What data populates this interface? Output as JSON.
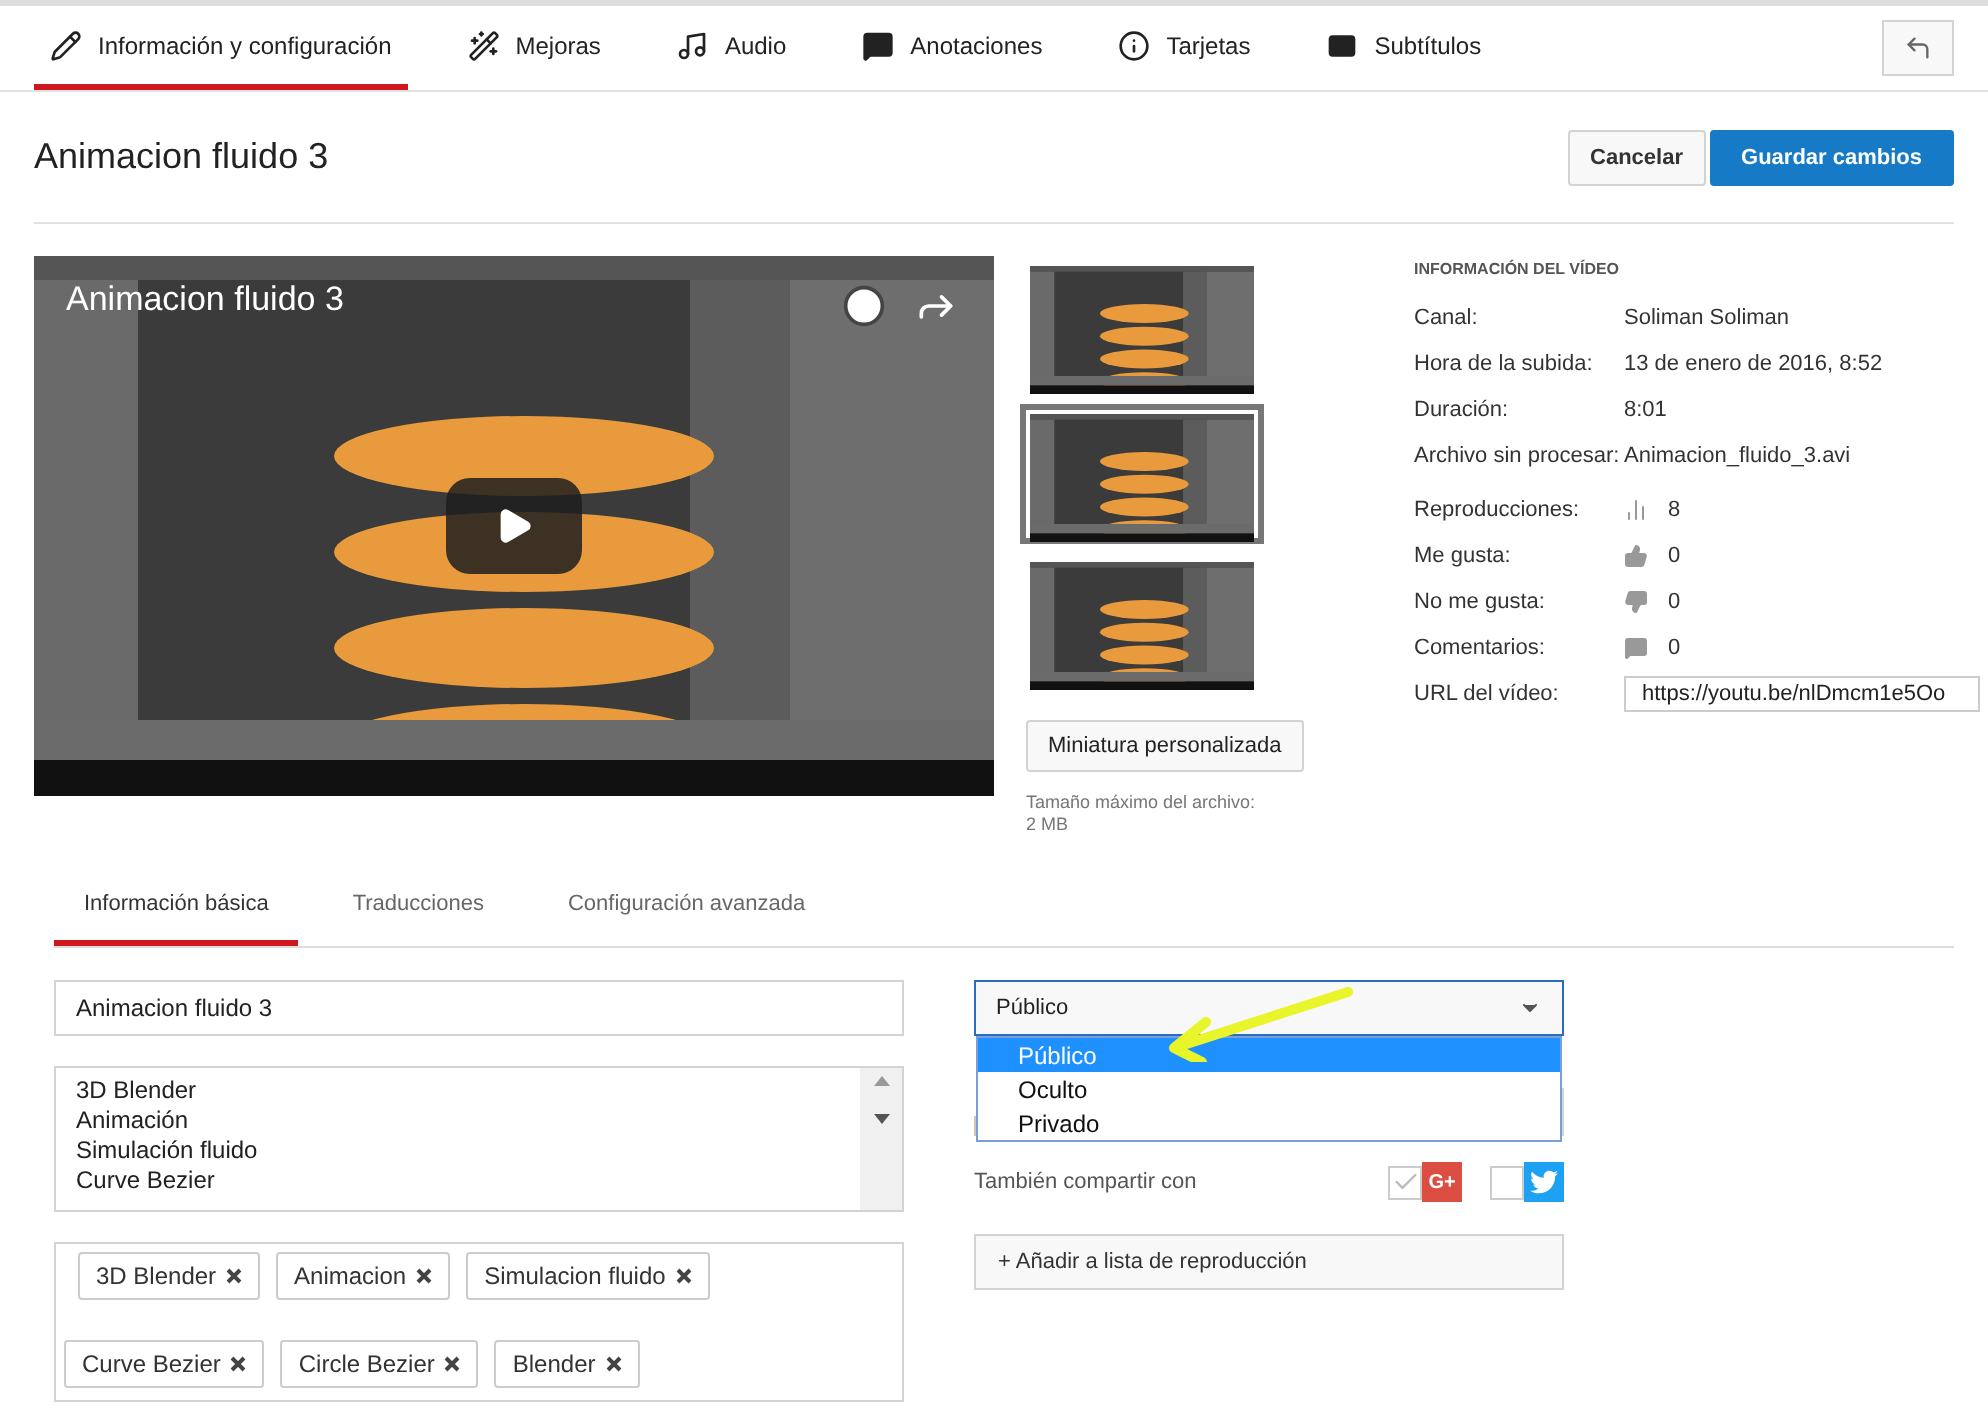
{
  "top_tabs": [
    {
      "label": "Información y configuración",
      "selected": true
    },
    {
      "label": "Mejoras",
      "selected": false
    },
    {
      "label": "Audio",
      "selected": false
    },
    {
      "label": "Anotaciones",
      "selected": false
    },
    {
      "label": "Tarjetas",
      "selected": false
    },
    {
      "label": "Subtítulos",
      "selected": false
    }
  ],
  "title": "Animacion fluido 3",
  "actions": {
    "cancel": "Cancelar",
    "save": "Guardar cambios"
  },
  "player": {
    "title": "Animacion fluido 3"
  },
  "thumbnails": [
    {
      "selected": false
    },
    {
      "selected": true
    },
    {
      "selected": false
    }
  ],
  "custom_thumbnail": {
    "button": "Miniatura personalizada",
    "note": "Tamaño máximo del archivo: 2 MB"
  },
  "video_info": {
    "heading": "INFORMACIÓN DEL VÍDEO",
    "rows": [
      {
        "label": "Canal:",
        "value": "Soliman Soliman"
      },
      {
        "label": "Hora de la subida:",
        "value": "13 de enero de 2016, 8:52"
      },
      {
        "label": "Duración:",
        "value": "8:01"
      },
      {
        "label": "Archivo sin procesar:",
        "value": "Animacion_fluido_3.avi"
      }
    ],
    "stats": [
      {
        "label": "Reproducciones:",
        "value": "8"
      },
      {
        "label": "Me gusta:",
        "value": "0"
      },
      {
        "label": "No me gusta:",
        "value": "0"
      },
      {
        "label": "Comentarios:",
        "value": "0"
      }
    ],
    "url": {
      "label": "URL del vídeo:",
      "value": "https://youtu.be/nlDmcm1e5Oo"
    }
  },
  "sub_tabs": [
    {
      "label": "Información básica",
      "selected": true
    },
    {
      "label": "Traducciones",
      "selected": false
    },
    {
      "label": "Configuración avanzada",
      "selected": false
    }
  ],
  "form": {
    "title_value": "Animacion fluido 3",
    "description_lines": [
      "3D Blender",
      "Animación",
      "Simulación fluido",
      "Curve Bezier"
    ],
    "tags": [
      "3D Blender",
      "Animacion",
      "Simulacion fluido",
      "Curve Bezier",
      "Circle Bezier",
      "Blender"
    ]
  },
  "privacy": {
    "value": "Público",
    "options": [
      {
        "label": "Público",
        "selected": true
      },
      {
        "label": "Oculto",
        "selected": false
      },
      {
        "label": "Privado",
        "selected": false
      }
    ]
  },
  "share": {
    "label": "También compartir con",
    "services": [
      {
        "kind": "gplus",
        "label": "G+",
        "checked": true
      },
      {
        "kind": "twitter",
        "checked": false
      }
    ]
  },
  "playlist_button": "+ Añadir a lista de reproducción"
}
